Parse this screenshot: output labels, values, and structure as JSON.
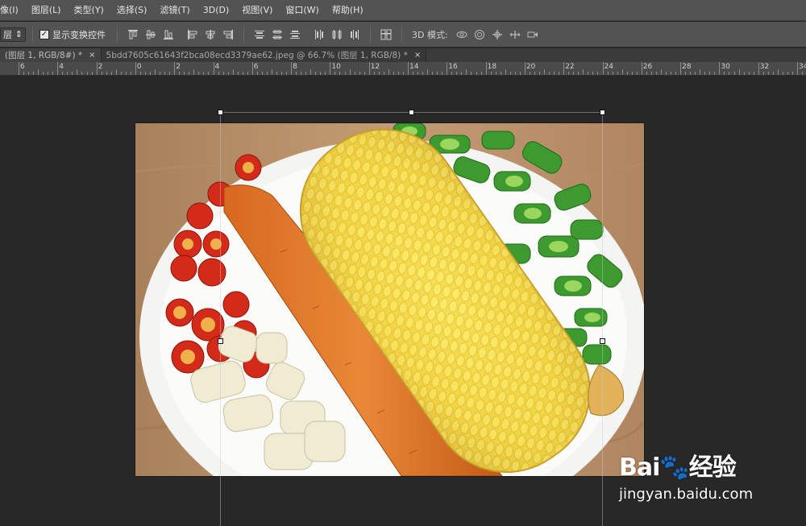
{
  "menubar": {
    "items": [
      "像(I)",
      "图层(L)",
      "类型(Y)",
      "选择(S)",
      "滤镜(T)",
      "3D(D)",
      "视图(V)",
      "窗口(W)",
      "帮助(H)"
    ]
  },
  "options": {
    "layer_select_value": "层",
    "show_transform_label": "显示变换控件",
    "show_transform_checked": true,
    "mode_label": "3D 模式:",
    "align_icons": [
      "align-top-edges-icon",
      "align-vertical-centers-icon",
      "align-bottom-edges-icon",
      "align-left-edges-icon",
      "align-horizontal-centers-icon",
      "align-right-edges-icon"
    ],
    "distribute_icons": [
      "distribute-top-icon",
      "distribute-vertical-center-icon",
      "distribute-bottom-icon",
      "distribute-left-icon",
      "distribute-horizontal-center-icon",
      "distribute-right-icon"
    ],
    "auto_align_icon": "auto-align-icon",
    "mode_icons": [
      "rotate-3d-icon",
      "roll-3d-icon",
      "drag-3d-icon",
      "slide-3d-icon",
      "scale-3d-icon"
    ]
  },
  "tabs": [
    {
      "label": "(图层 1, RGB/8#) *",
      "close": "×"
    },
    {
      "label": "5bdd7605c61643f2bca08ecd3379ae62.jpeg @ 66.7% (图层 1, RGB/8) *",
      "close": "×"
    }
  ],
  "ruler": {
    "labels": [
      "6",
      "4",
      "2",
      "0",
      "2",
      "4",
      "6",
      "8",
      "10",
      "12",
      "14",
      "16",
      "18",
      "20",
      "22",
      "24",
      "26",
      "28",
      "30",
      "32",
      "34"
    ]
  },
  "watermark": {
    "brand": "Bai🐾经验",
    "url": "jingyan.baidu.com"
  },
  "colors": {
    "workspace": "#282828",
    "panel": "#535353",
    "tab_active": "#424242"
  }
}
